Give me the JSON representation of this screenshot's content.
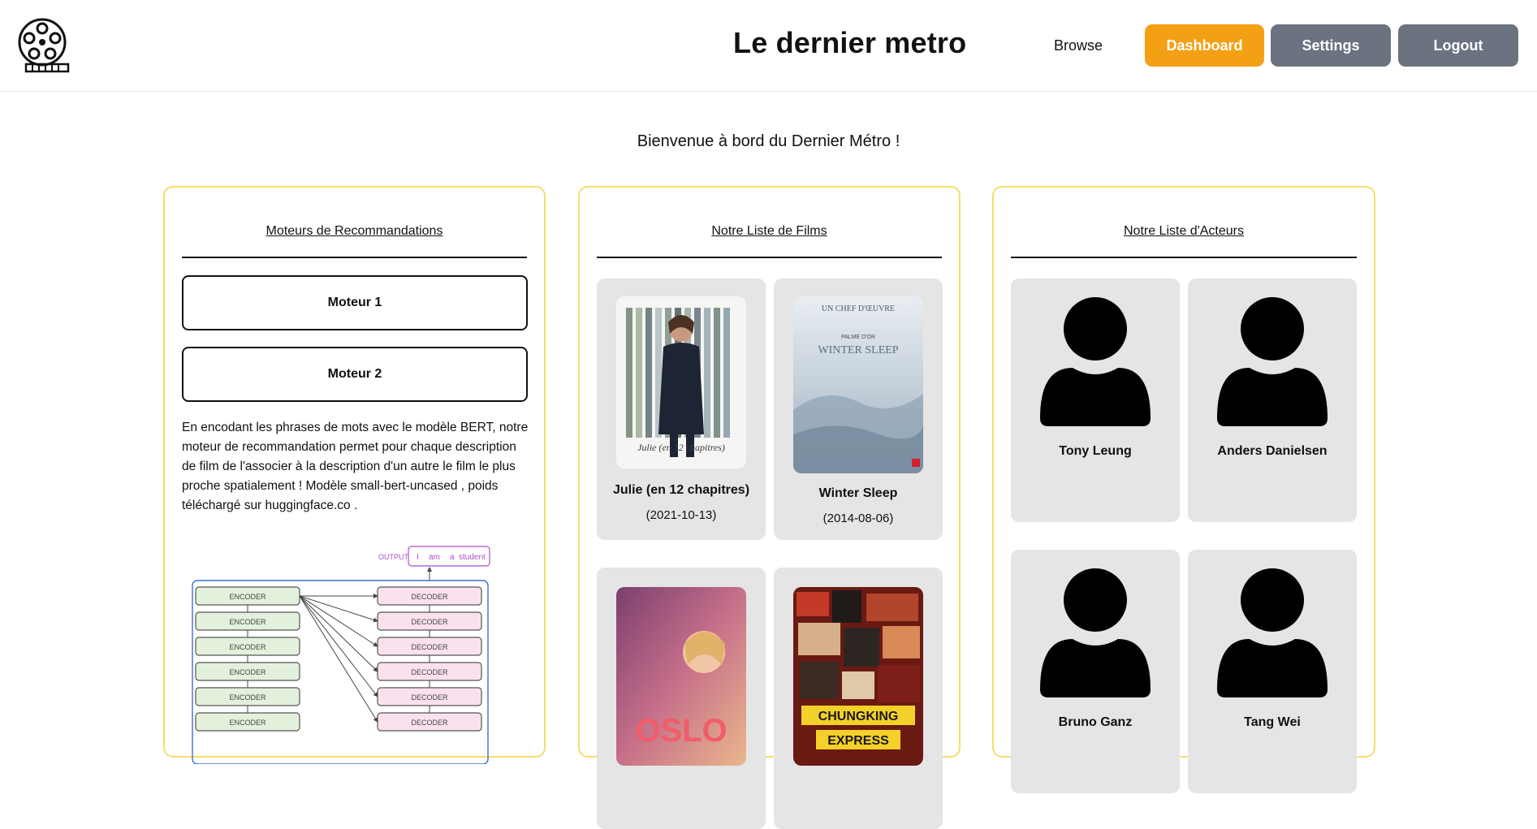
{
  "header": {
    "title": "Le dernier metro",
    "browse_label": "Browse",
    "dashboard_label": "Dashboard",
    "settings_label": "Settings",
    "logout_label": "Logout",
    "logo_icon": "film-reel-icon"
  },
  "welcome": "Bienvenue à bord du Dernier Métro !",
  "recommendations": {
    "title": "Moteurs de Recommandations",
    "engines": [
      "Moteur 1",
      "Moteur 2"
    ],
    "description": "En encodant les phrases de mots avec le modèle BERT, notre moteur de recommandation permet pour chaque description de film de l'associer à la description d'un autre le film le plus proche spatialement ! Modèle small-bert-uncased , poids téléchargé sur huggingface.co .",
    "diagram": {
      "output_label": "OUTPUT",
      "output_tokens": [
        "I",
        "am",
        "a",
        "student"
      ],
      "encoder_label": "ENCODER",
      "decoder_label": "DECODER"
    }
  },
  "films": {
    "title": "Notre Liste de Films",
    "items": [
      {
        "title": "Julie (en 12 chapitres)",
        "date": "(2021-10-13)"
      },
      {
        "title": "Winter Sleep",
        "date": "(2014-08-06)"
      },
      {
        "title": "",
        "date": ""
      },
      {
        "title": "",
        "date": ""
      }
    ],
    "poster_text": {
      "julie_script": "Julie (en 12 chapitres)",
      "winter_top": "UN CHEF D'ŒUVRE",
      "winter_palme": "PALME D'OR",
      "winter_title": "WINTER SLEEP",
      "oslo_title": "OSLO",
      "chungking_title": "CHUNGKING",
      "chungking_title2": "EXPRESS"
    }
  },
  "actors": {
    "title": "Notre Liste d'Acteurs",
    "items": [
      "Tony Leung",
      "Anders Danielsen",
      "Bruno Ganz",
      "Tang Wei"
    ],
    "avatar_icon": "user-silhouette-icon"
  },
  "colors": {
    "accent": "#f4a015",
    "button_gray": "#6b7280",
    "panel_border": "#f6dd6e",
    "card_bg": "#e5e5e5"
  }
}
